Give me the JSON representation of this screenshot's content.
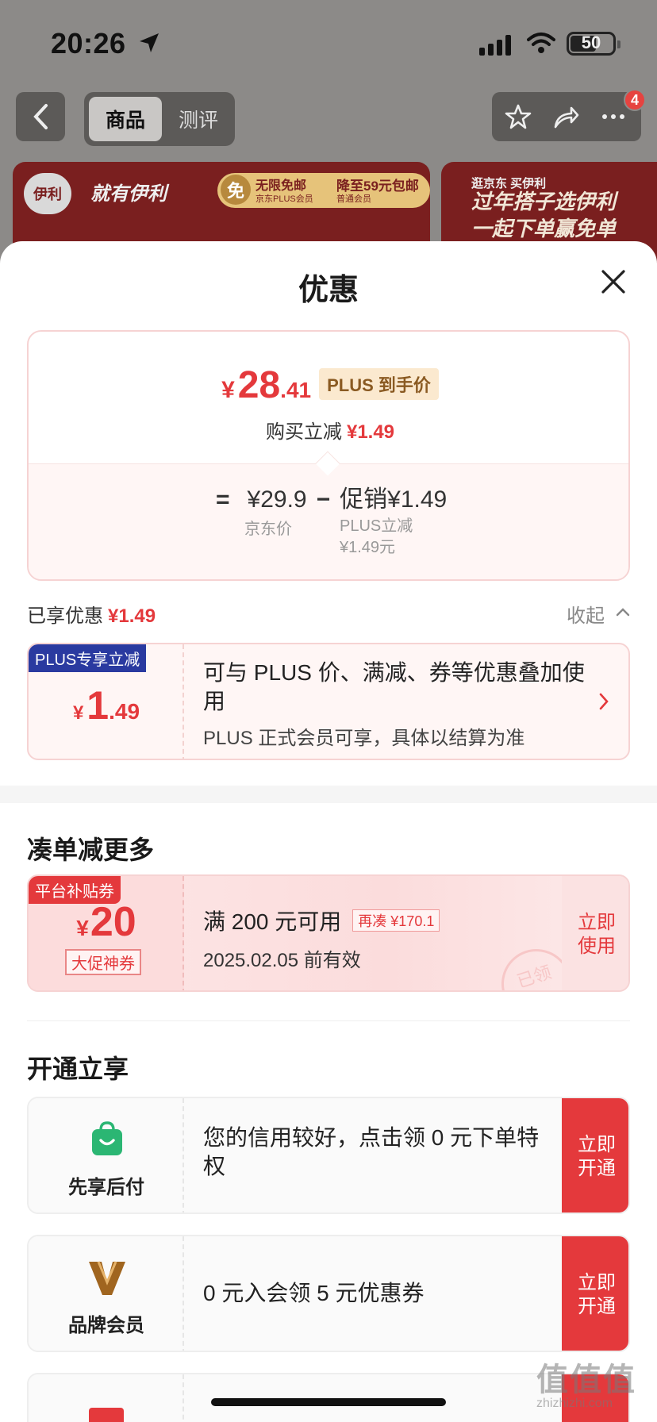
{
  "status": {
    "time": "20:26",
    "battery": "50"
  },
  "nav": {
    "tabs": [
      {
        "label": "商品"
      },
      {
        "label": "测评"
      }
    ],
    "badge": "4"
  },
  "banner": {
    "logo": "伊利",
    "logo2": "就有伊利",
    "free_icon": "免",
    "free_title": "无限免邮",
    "free_sub": "京东PLUS会员",
    "discount_title": "降至59元包邮",
    "discount_sub": "普通会员",
    "right_l1": "逛京东 买伊利",
    "right_l2": "过年搭子选伊利",
    "right_l3": "一起下单赢免单"
  },
  "sheet": {
    "title": "优惠",
    "price": {
      "yen": "¥",
      "int": "28",
      "dec": ".41",
      "tag": "PLUS 到手价",
      "sub_label": "购买立减",
      "sub_value": "¥1.49",
      "eq": "=",
      "base": "¥29.9",
      "minus": "−",
      "promo": "促销¥1.49",
      "base_label": "京东价",
      "promo_label1": "PLUS立减",
      "promo_label2": "¥1.49元"
    },
    "enjoyed_label": "已享优惠",
    "enjoyed_value": "¥1.49",
    "collapse": "收起",
    "plus_coupon": {
      "badge": "PLUS专享立减",
      "yen": "¥",
      "int": "1",
      "dec": ".49",
      "title": "可与 PLUS 价、满减、券等优惠叠加使用",
      "note": "PLUS 正式会员可享，具体以结算为准"
    },
    "section_more": "凑单减更多",
    "coupon": {
      "badge": "平台补贴券",
      "yen": "¥",
      "amount": "20",
      "tag": "大促神券",
      "title": "满 200 元可用",
      "extra": "再凑 ¥170.1",
      "expiry": "2025.02.05 前有效",
      "btn": "立即使用",
      "stamp": "已领"
    },
    "section_open": "开通立享",
    "services": [
      {
        "icon": "shopping-bag-icon",
        "label": "先享后付",
        "text": "您的信用较好，点击领 0 元下单特权",
        "btn": "立即开通"
      },
      {
        "icon": "brand-v-icon",
        "label": "品牌会员",
        "text": "0 元入会领 5 元优惠券",
        "btn": "立即开通"
      }
    ]
  },
  "watermark": "值值值",
  "watermark_url": "zhizhizhi.com",
  "colors": {
    "accent_red": "#e4393c",
    "plus_blue": "#2a3aa0",
    "tag_gold": "#fbe9cf"
  }
}
